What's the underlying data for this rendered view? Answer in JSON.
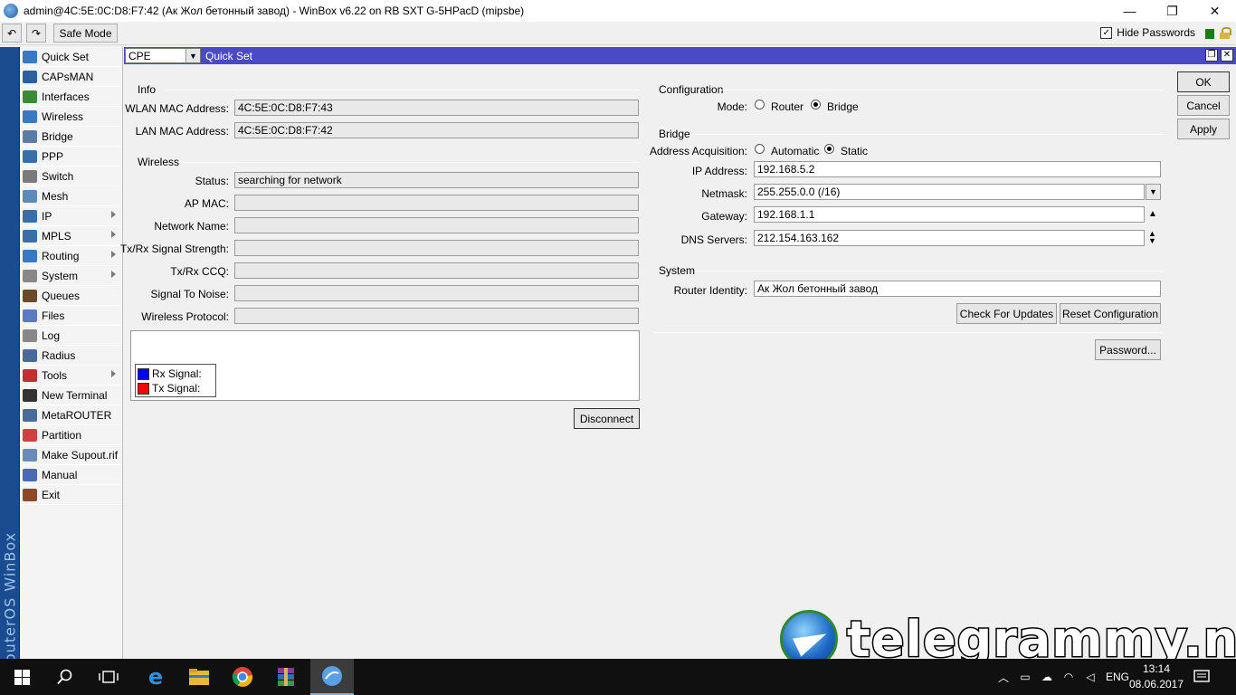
{
  "window": {
    "title": "admin@4C:5E:0C:D8:F7:42 (Ак Жол бетонный завод) - WinBox v6.22 on RB SXT G-5HPacD (mipsbe)",
    "minimize": "—",
    "maximize": "❐",
    "close": "✕"
  },
  "toolbar": {
    "undo": "↶",
    "redo": "↷",
    "safe_mode": "Safe Mode",
    "hide_passwords": "Hide Passwords",
    "hide_passwords_checked": "✓",
    "status_color": "#1a7a1a"
  },
  "brand": "RouterOS WinBox",
  "sidebar": {
    "items": [
      {
        "label": "Quick Set",
        "icon": "quickset-icon",
        "submenu": false
      },
      {
        "label": "CAPsMAN",
        "icon": "capsman-icon",
        "submenu": false
      },
      {
        "label": "Interfaces",
        "icon": "interfaces-icon",
        "submenu": false
      },
      {
        "label": "Wireless",
        "icon": "wireless-icon",
        "submenu": false
      },
      {
        "label": "Bridge",
        "icon": "bridge-icon",
        "submenu": false
      },
      {
        "label": "PPP",
        "icon": "ppp-icon",
        "submenu": false
      },
      {
        "label": "Switch",
        "icon": "switch-icon",
        "submenu": false
      },
      {
        "label": "Mesh",
        "icon": "mesh-icon",
        "submenu": false
      },
      {
        "label": "IP",
        "icon": "ip-icon",
        "submenu": true
      },
      {
        "label": "MPLS",
        "icon": "mpls-icon",
        "submenu": true
      },
      {
        "label": "Routing",
        "icon": "routing-icon",
        "submenu": true
      },
      {
        "label": "System",
        "icon": "gear-icon",
        "submenu": true
      },
      {
        "label": "Queues",
        "icon": "queues-icon",
        "submenu": false
      },
      {
        "label": "Files",
        "icon": "folder-icon",
        "submenu": false
      },
      {
        "label": "Log",
        "icon": "log-icon",
        "submenu": false
      },
      {
        "label": "Radius",
        "icon": "radius-icon",
        "submenu": false
      },
      {
        "label": "Tools",
        "icon": "tools-icon",
        "submenu": true
      },
      {
        "label": "New Terminal",
        "icon": "terminal-icon",
        "submenu": false
      },
      {
        "label": "MetaROUTER",
        "icon": "metarouter-icon",
        "submenu": false
      },
      {
        "label": "Partition",
        "icon": "partition-icon",
        "submenu": false
      },
      {
        "label": "Make Supout.rif",
        "icon": "supout-icon",
        "submenu": false
      },
      {
        "label": "Manual",
        "icon": "manual-icon",
        "submenu": false
      },
      {
        "label": "Exit",
        "icon": "exit-icon",
        "submenu": false
      }
    ]
  },
  "panel": {
    "mode_select": "CPE",
    "title": "Quick Set",
    "restore": "❐",
    "close": "✕"
  },
  "info": {
    "title": "Info",
    "wlan_mac_label": "WLAN MAC Address:",
    "wlan_mac": "4C:5E:0C:D8:F7:43",
    "lan_mac_label": "LAN MAC Address:",
    "lan_mac": "4C:5E:0C:D8:F7:42"
  },
  "wireless": {
    "title": "Wireless",
    "status_label": "Status:",
    "status": "searching for network",
    "ap_mac_label": "AP MAC:",
    "ap_mac": "",
    "network_name_label": "Network Name:",
    "network_name": "",
    "signal_strength_label": "Tx/Rx Signal Strength:",
    "signal_strength": "",
    "ccq_label": "Tx/Rx CCQ:",
    "ccq": "",
    "snr_label": "Signal To Noise:",
    "snr": "",
    "protocol_label": "Wireless Protocol:",
    "protocol": "",
    "legend_rx": "Rx Signal:",
    "legend_tx": "Tx Signal:",
    "rx_color": "#0000ff",
    "tx_color": "#ff0000",
    "disconnect": "Disconnect"
  },
  "configuration": {
    "title": "Configuration",
    "mode_label": "Mode:",
    "router": "Router",
    "bridge": "Bridge",
    "selected": "Bridge"
  },
  "bridge": {
    "title": "Bridge",
    "addr_acq_label": "Address Acquisition:",
    "automatic": "Automatic",
    "static": "Static",
    "selected": "Static",
    "ip_label": "IP Address:",
    "ip": "192.168.5.2",
    "netmask_label": "Netmask:",
    "netmask": "255.255.0.0 (/16)",
    "gateway_label": "Gateway:",
    "gateway": "192.168.1.1",
    "dns_label": "DNS Servers:",
    "dns": "212.154.163.162"
  },
  "system": {
    "title": "System",
    "identity_label": "Router Identity:",
    "identity": "Ак Жол бетонный завод",
    "check_updates": "Check For Updates",
    "reset_config": "Reset Configuration",
    "password": "Password..."
  },
  "actions": {
    "ok": "OK",
    "cancel": "Cancel",
    "apply": "Apply"
  },
  "watermark": "telegrammy.net",
  "taskbar": {
    "lang": "ENG",
    "time": "13:14",
    "date": "08.06.2017"
  }
}
